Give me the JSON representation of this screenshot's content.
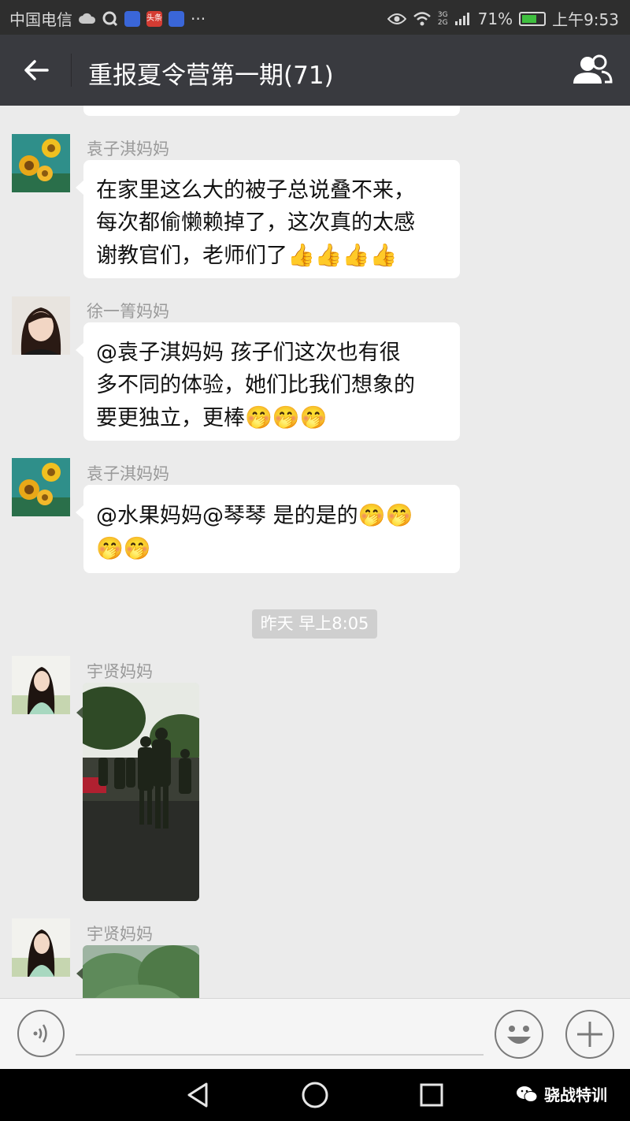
{
  "status_bar": {
    "carrier": "中国电信",
    "app_badge": "头条",
    "more": "···",
    "network_top": "3G",
    "network_bottom": "2G",
    "battery": "71%",
    "battery_level": 0.71,
    "time": "上午9:53"
  },
  "header": {
    "title": "重报夏令营第一期(71)"
  },
  "messages": [
    {
      "sender": "袁子淇妈妈",
      "lines": [
        "在家里这么大的被子总说叠不来，",
        "每次都偷懒赖掉了，这次真的太感",
        "谢教官们，老师们了"
      ],
      "emoji": "👍👍👍👍"
    },
    {
      "sender": "徐一箐妈妈",
      "lines": [
        "@袁子淇妈妈 孩子们这次也有很",
        "多不同的体验，她们比我们想象的",
        "要更独立，更棒"
      ],
      "emoji": "🤭🤭🤭"
    },
    {
      "sender": "袁子淇妈妈",
      "lines": [
        "@水果妈妈@琴琴 是的是的"
      ],
      "emoji_inline": "🤭🤭",
      "emoji_line2": "🤭🤭"
    }
  ],
  "timestamp": "昨天 早上8:05",
  "photo_messages": [
    {
      "sender": "宇贤妈妈"
    },
    {
      "sender": "宇贤妈妈"
    }
  ],
  "watermark": "骁战特训",
  "colors": {
    "nav_bg": "#393a3f",
    "status_bg": "#2e2e2e",
    "chat_bg": "#ebebeb",
    "bubble_bg": "#ffffff",
    "battery_green": "#3fbf3f"
  }
}
